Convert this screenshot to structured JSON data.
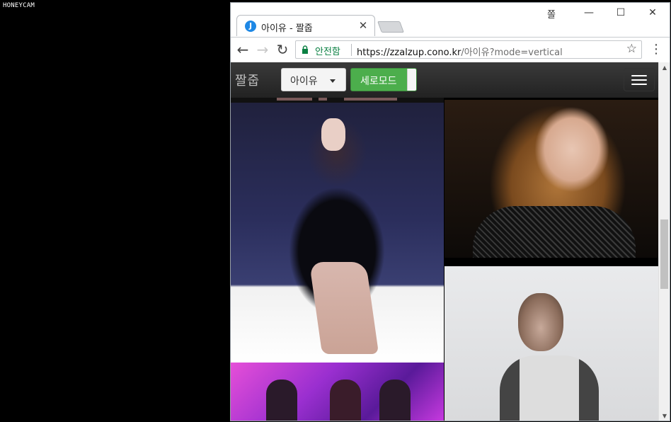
{
  "watermark": "HONEYCAM",
  "browser": {
    "tab": {
      "favicon_letter": "J",
      "title": "아이유 - 짤줍",
      "close_glyph": "✕"
    },
    "window_controls": {
      "profile": "쫄",
      "minimize": "—",
      "maximize": "☐",
      "close": "✕"
    },
    "toolbar": {
      "back": "←",
      "forward": "→",
      "reload": "↻",
      "secure_label": "안전함",
      "url_host": "https://zzalzup.cono.kr",
      "url_rest": "/아이유?mode=vertical",
      "star": "☆",
      "menu": "⋮"
    }
  },
  "site": {
    "brand": "짤줍",
    "dropdown_label": "아이유",
    "toggle_label": "세로모드"
  },
  "scrollbar": {
    "up": "▲",
    "down": "▼"
  }
}
